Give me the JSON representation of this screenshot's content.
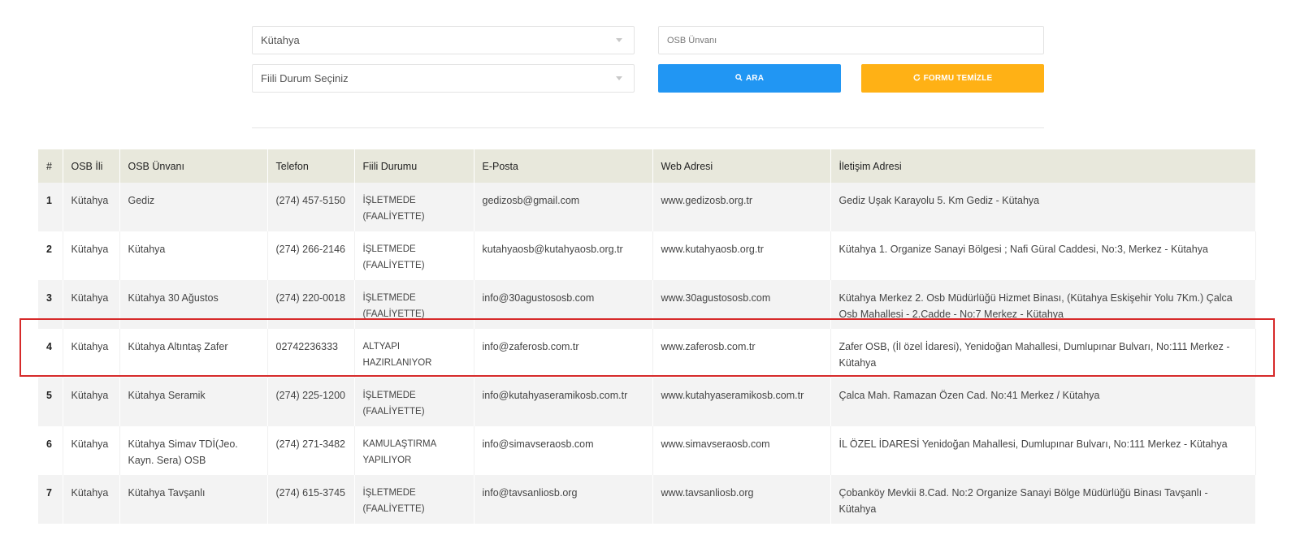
{
  "form": {
    "province_select": "Kütahya",
    "status_select": "Fiili Durum Seçiniz",
    "osb_name_placeholder": "OSB Ünvanı",
    "search_button": "ARA",
    "clear_button": "FORMU TEMİZLE",
    "search_color": "#2196f3",
    "clear_color": "#ffb115"
  },
  "table": {
    "headers": [
      "#",
      "OSB İli",
      "OSB Ünvanı",
      "Telefon",
      "Fiili Durumu",
      "E-Posta",
      "Web Adresi",
      "İletişim Adresi"
    ],
    "rows": [
      {
        "num": "1",
        "city": "Kütahya",
        "name": "Gediz",
        "phone": "(274) 457-5150",
        "status": "İŞLETMEDE (FAALİYETTE)",
        "email": "gedizosb@gmail.com",
        "web": "www.gedizosb.org.tr",
        "address": "Gediz Uşak Karayolu 5. Km Gediz - Kütahya"
      },
      {
        "num": "2",
        "city": "Kütahya",
        "name": "Kütahya",
        "phone": "(274) 266-2146",
        "status": "İŞLETMEDE (FAALİYETTE)",
        "email": "kutahyaosb@kutahyaosb.org.tr",
        "web": "www.kutahyaosb.org.tr",
        "address": "Kütahya 1. Organize Sanayi Bölgesi ; Nafi Güral Caddesi, No:3, Merkez - Kütahya"
      },
      {
        "num": "3",
        "city": "Kütahya",
        "name": "Kütahya 30 Ağustos",
        "phone": "(274) 220-0018",
        "status": "İŞLETMEDE (FAALİYETTE)",
        "email": "info@30agustososb.com",
        "web": "www.30agustososb.com",
        "address": "Kütahya Merkez 2. Osb Müdürlüğü Hizmet Binası, (Kütahya Eskişehir Yolu 7Km.) Çalca Osb Mahallesi - 2.Cadde - No:7 Merkez - Kütahya"
      },
      {
        "num": "4",
        "city": "Kütahya",
        "name": "Kütahya Altıntaş Zafer",
        "phone": "02742236333",
        "status": "ALTYAPI HAZIRLANIYOR",
        "email": "info@zaferosb.com.tr",
        "web": "www.zaferosb.com.tr",
        "address": "Zafer OSB, (İl özel İdaresi), Yenidoğan Mahallesi, Dumlupınar Bulvarı, No:111 Merkez - Kütahya"
      },
      {
        "num": "5",
        "city": "Kütahya",
        "name": "Kütahya Seramik",
        "phone": "(274) 225-1200",
        "status": "İŞLETMEDE (FAALİYETTE)",
        "email": "info@kutahyaseramikosb.com.tr",
        "web": "www.kutahyaseramikosb.com.tr",
        "address": "Çalca Mah. Ramazan Özen Cad. No:41 Merkez / Kütahya"
      },
      {
        "num": "6",
        "city": "Kütahya",
        "name": "Kütahya Simav TDİ(Jeo. Kayn. Sera) OSB",
        "phone": "(274) 271-3482",
        "status": "KAMULAŞTIRMA YAPILIYOR",
        "email": "info@simavseraosb.com",
        "web": "www.simavseraosb.com",
        "address": "İL ÖZEL İDARESİ Yenidoğan Mahallesi, Dumlupınar Bulvarı, No:111 Merkez - Kütahya"
      },
      {
        "num": "7",
        "city": "Kütahya",
        "name": "Kütahya Tavşanlı",
        "phone": "(274) 615-3745",
        "status": "İŞLETMEDE (FAALİYETTE)",
        "email": "info@tavsanliosb.org",
        "web": "www.tavsanliosb.org",
        "address": "Çobanköy Mevkii 8.Cad. No:2 Organize Sanayi Bölge Müdürlüğü Binası Tavşanlı - Kütahya"
      }
    ]
  },
  "highlight_color": "#d62a2a"
}
